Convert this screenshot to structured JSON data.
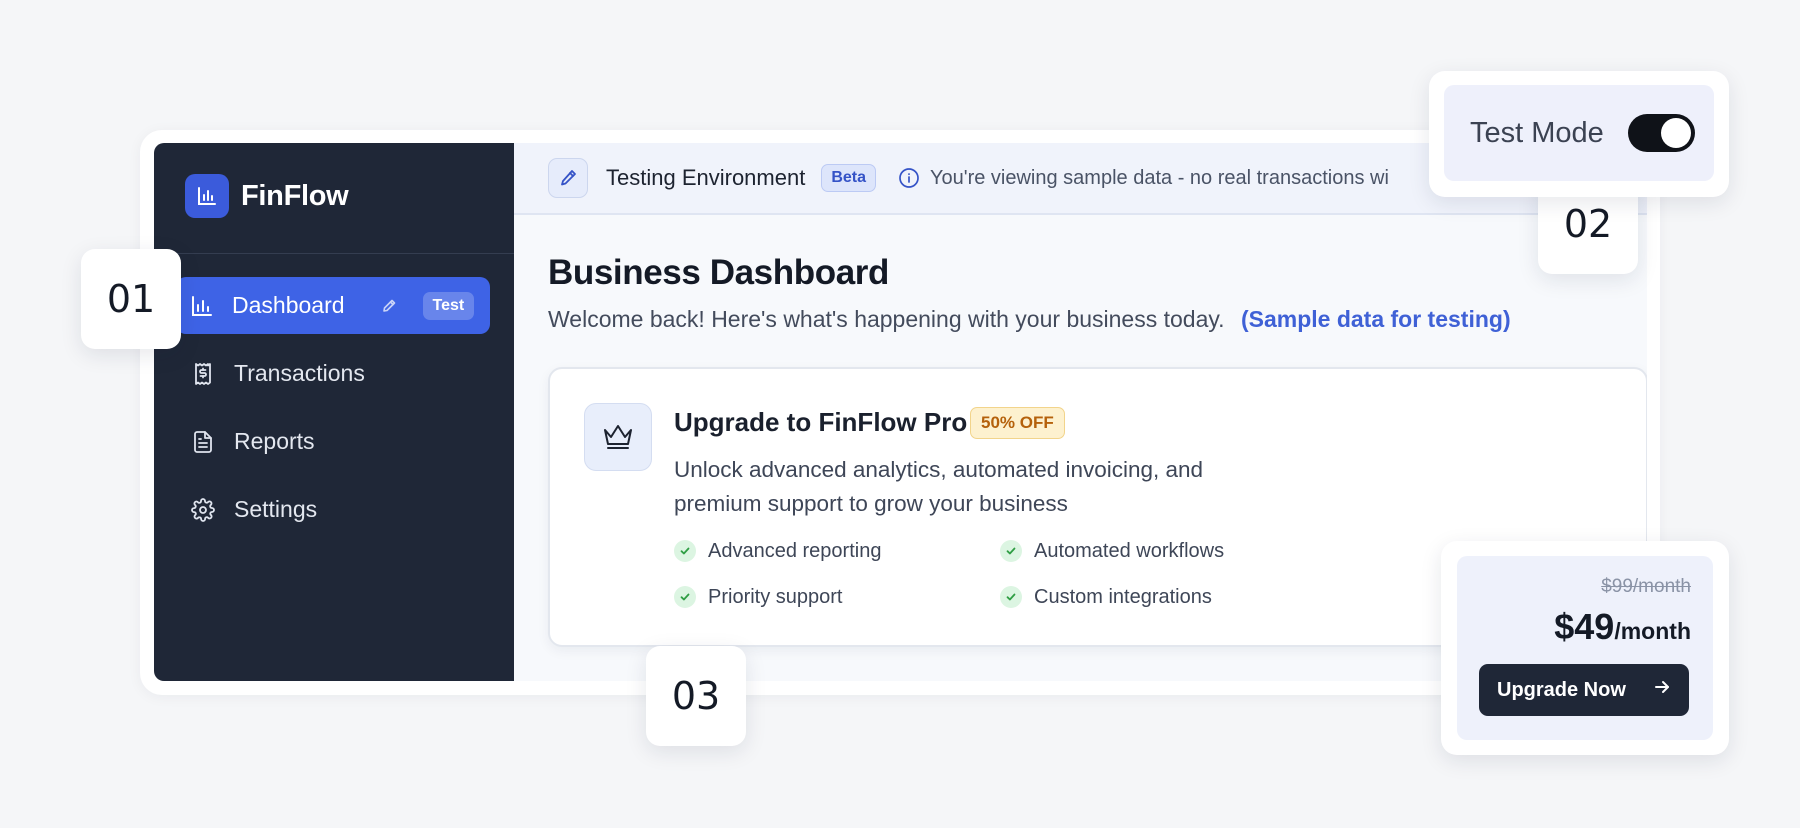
{
  "sidebar": {
    "brand": "FinFlow",
    "items": [
      {
        "label": "Dashboard",
        "badge": "Test",
        "active": true
      },
      {
        "label": "Transactions"
      },
      {
        "label": "Reports"
      },
      {
        "label": "Settings"
      }
    ]
  },
  "env_bar": {
    "title": "Testing Environment",
    "badge": "Beta",
    "note": "You're viewing sample data - no real transactions wi"
  },
  "main": {
    "title": "Business Dashboard",
    "subtitle": "Welcome back! Here's what's happening with your business today.",
    "subtitle_link": "(Sample data for testing)"
  },
  "upgrade": {
    "title": "Upgrade to FinFlow Pro",
    "discount_badge": "50% OFF",
    "description": "Unlock advanced analytics, automated invoicing, and premium support to grow your business",
    "features": [
      "Advanced reporting",
      "Automated workflows",
      "Priority support",
      "Custom integrations"
    ]
  },
  "toggle": {
    "label": "Test Mode",
    "on": true
  },
  "pricing": {
    "old_price": "$99/month",
    "new_amount": "$49",
    "new_period": "/month",
    "button_label": "Upgrade Now"
  },
  "callouts": [
    "01",
    "02",
    "03"
  ],
  "colors": {
    "sidebar_bg": "#1f2737",
    "accent": "#3e63e6",
    "link": "#3f61d6",
    "badge_warn": "#b5610b",
    "check_green": "#2f9e44"
  }
}
